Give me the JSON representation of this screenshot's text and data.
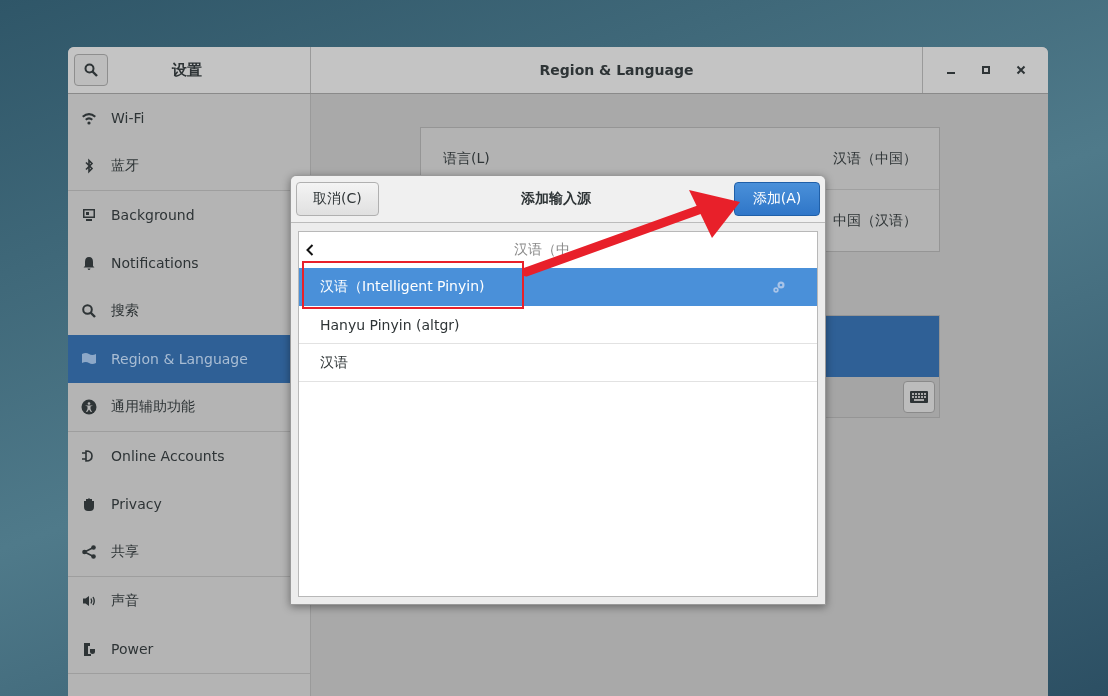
{
  "window": {
    "title": "Region & Language"
  },
  "sidebar": {
    "title": "设置",
    "groups": [
      {
        "items": [
          {
            "label": "Wi-Fi",
            "selected": false
          },
          {
            "label": "蓝牙",
            "selected": false
          }
        ]
      },
      {
        "items": [
          {
            "label": "Background",
            "selected": false
          },
          {
            "label": "Notifications",
            "selected": false
          },
          {
            "label": "搜索",
            "selected": false
          },
          {
            "label": "Region & Language",
            "selected": true
          },
          {
            "label": "通用辅助功能",
            "selected": false
          }
        ]
      },
      {
        "items": [
          {
            "label": "Online Accounts",
            "selected": false
          },
          {
            "label": "Privacy",
            "selected": false
          },
          {
            "label": "共享",
            "selected": false
          }
        ]
      },
      {
        "items": [
          {
            "label": "声音",
            "selected": false
          },
          {
            "label": "Power",
            "selected": false
          }
        ]
      }
    ]
  },
  "language_rows": [
    {
      "label": "语言(L)",
      "value": "汉语（中国）"
    },
    {
      "value": "中国（汉语）"
    }
  ],
  "input_sources": [
    {
      "selected": true
    }
  ],
  "dialog": {
    "title": "添加输入源",
    "cancel": "取消(C)",
    "add": "添加(A)",
    "heading": "汉语（中",
    "items": [
      {
        "label": "汉语（Intelligent Pinyin)",
        "selected": true,
        "settings": true
      },
      {
        "label": "Hanyu Pinyin (altgr)",
        "selected": false,
        "settings": false
      },
      {
        "label": "汉语",
        "selected": false,
        "settings": false
      }
    ]
  }
}
